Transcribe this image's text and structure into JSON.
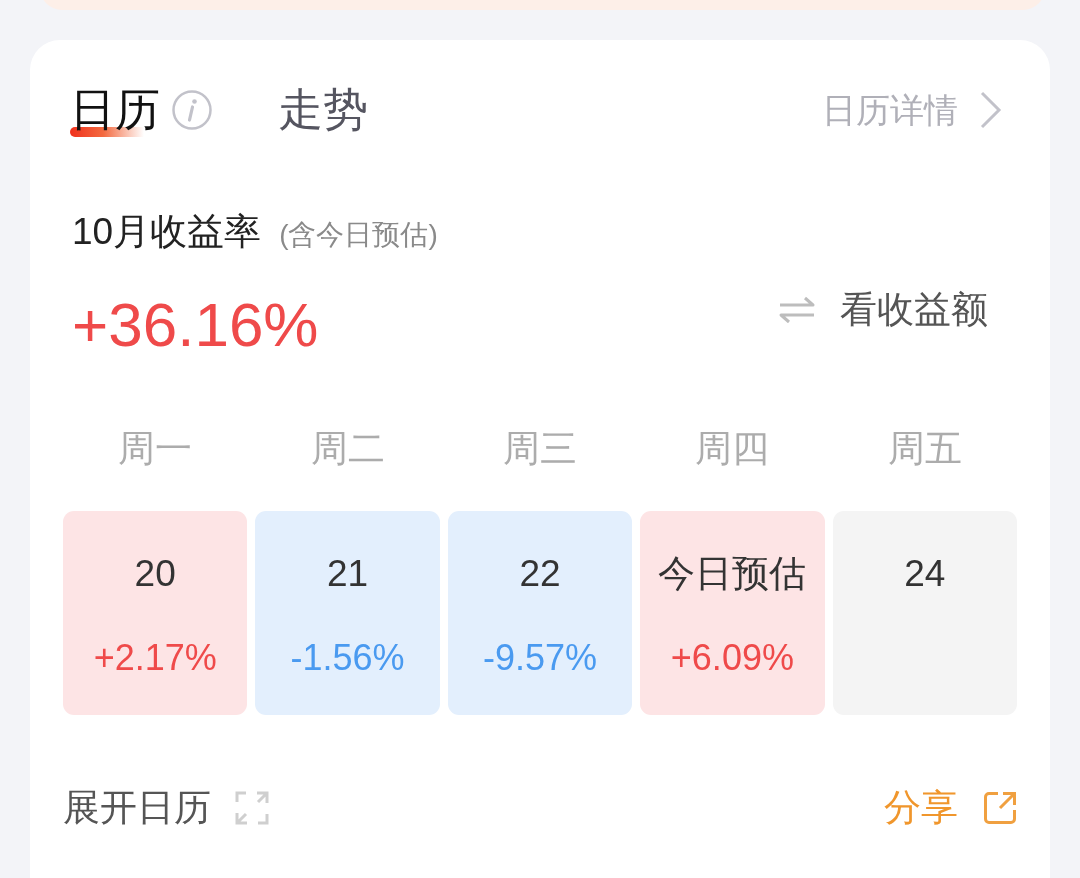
{
  "tabs": [
    {
      "label": "日历",
      "selected": true,
      "info_icon": true
    },
    {
      "label": "走势",
      "selected": false,
      "info_icon": false
    }
  ],
  "details_link": {
    "label": "日历详情"
  },
  "summary": {
    "title": "10月收益率",
    "note": "(含今日预估)",
    "value": "+36.16%",
    "toggle": "看收益额"
  },
  "weekdays": [
    "周一",
    "周二",
    "周三",
    "周四",
    "周五"
  ],
  "days": [
    {
      "label": "20",
      "change": "+2.17%",
      "kind": "gain"
    },
    {
      "label": "21",
      "change": "-1.56%",
      "kind": "loss"
    },
    {
      "label": "22",
      "change": "-9.57%",
      "kind": "loss"
    },
    {
      "label": "今日预估",
      "change": "+6.09%",
      "kind": "gain"
    },
    {
      "label": "24",
      "kind": "blank"
    }
  ],
  "footer": {
    "expand": "展开日历",
    "share": "分享"
  }
}
